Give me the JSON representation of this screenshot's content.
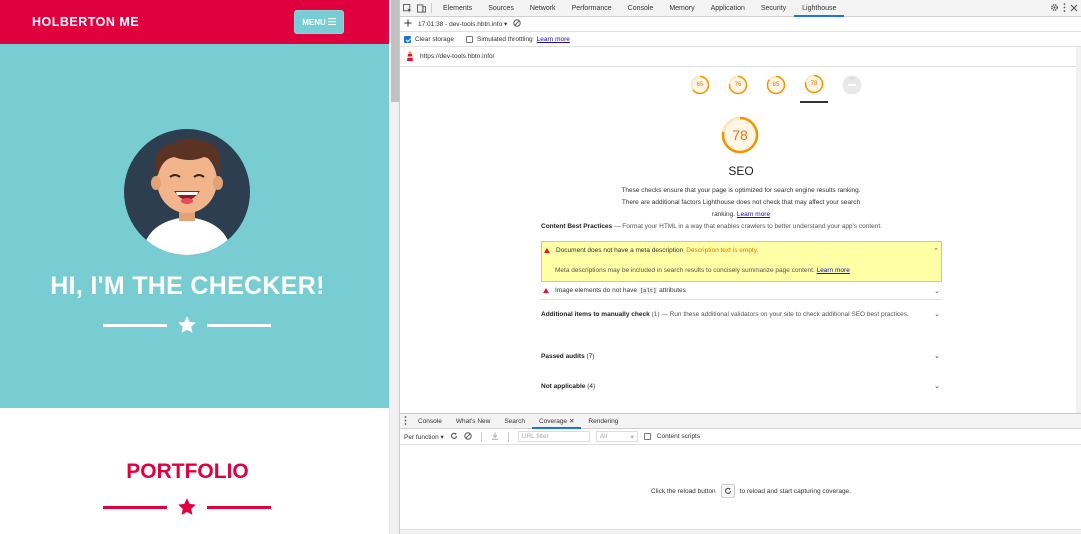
{
  "site": {
    "brand": "HOLBERTON ME",
    "menu_label": "MENU",
    "hero_title": "HI, I'M THE CHECKER!",
    "portfolio_title": "PORTFOLIO",
    "colors": {
      "primary": "#e0003e",
      "hero_bg": "#78cdd3",
      "avatar_bg": "#2c3e50"
    }
  },
  "devtools": {
    "tabs": [
      "Elements",
      "Sources",
      "Network",
      "Performance",
      "Console",
      "Memory",
      "Application",
      "Security",
      "Lighthouse"
    ],
    "active_tab": "Lighthouse",
    "report_selector": "17:01:38 - dev-tools.hbtn.info",
    "clear_storage_label": "Clear storage",
    "simulated_throttling_label": "Simulated throttling",
    "learn_more": "Learn more",
    "url": "https://dev-tools.hbtn.info/",
    "gauges": [
      {
        "score": "65",
        "active": false
      },
      {
        "score": "76",
        "active": false
      },
      {
        "score": "85",
        "active": false
      },
      {
        "score": "78",
        "active": true
      },
      {
        "score": "PWA",
        "active": false
      }
    ],
    "seo": {
      "score": "78",
      "title": "SEO",
      "description": "These checks ensure that your page is optimized for search engine results ranking. There are additional factors Lighthouse does not check that may affect your search ranking.",
      "description_link": "Learn more",
      "group_title": "Content Best Practices",
      "group_desc": "— Format your HTML in a way that enables crawlers to better understand your app's content.",
      "audit_meta_title": "Document does not have a meta description",
      "audit_meta_status": "Description text is empty.",
      "audit_meta_detail": "Meta descriptions may be included in search results to concisely summarize page content.",
      "audit_meta_link": "Learn more",
      "audit_img_prefix": "Image elements do not have",
      "audit_img_code": "[alt]",
      "audit_img_suffix": "attributes",
      "manual_title": "Additional items to manually check",
      "manual_count": "(1)",
      "manual_desc": "— Run these additional validators on your site to check additional SEO best practices.",
      "passed_label": "Passed audits",
      "passed_count": "(7)",
      "na_label": "Not applicable",
      "na_count": "(4)"
    },
    "drawer": {
      "tabs": [
        "Console",
        "What's New",
        "Search",
        "Coverage",
        "Rendering"
      ],
      "active_tab": "Coverage",
      "per_function": "Per function",
      "url_filter_placeholder": "URL filter",
      "type_filter": "All",
      "content_scripts_label": "Content scripts",
      "empty_prefix": "Click the reload button",
      "empty_suffix": "to reload and start capturing coverage."
    }
  }
}
